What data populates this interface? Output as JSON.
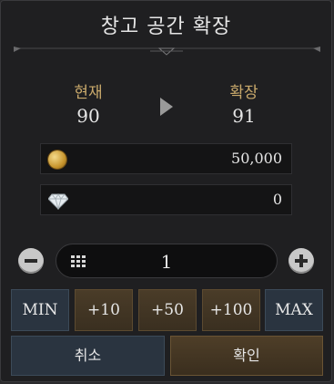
{
  "dialog": {
    "title": "창고 공간 확장"
  },
  "comparison": {
    "current_label": "현재",
    "current_value": "90",
    "expanded_label": "확장",
    "expanded_value": "91"
  },
  "costs": [
    {
      "icon": "silver-coin-icon",
      "value": "50,000"
    },
    {
      "icon": "diamond-icon",
      "value": "0"
    }
  ],
  "quantity": {
    "value": "1"
  },
  "step_buttons": {
    "min": "MIN",
    "plus10": "+10",
    "plus50": "+50",
    "plus100": "+100",
    "max": "MAX"
  },
  "actions": {
    "cancel": "취소",
    "confirm": "확인"
  },
  "colors": {
    "accent_gold": "#c9a96b",
    "panel_bg": "#1f1f21",
    "cancel_blue": "#2a3440",
    "confirm_brown": "#4e3e28"
  }
}
